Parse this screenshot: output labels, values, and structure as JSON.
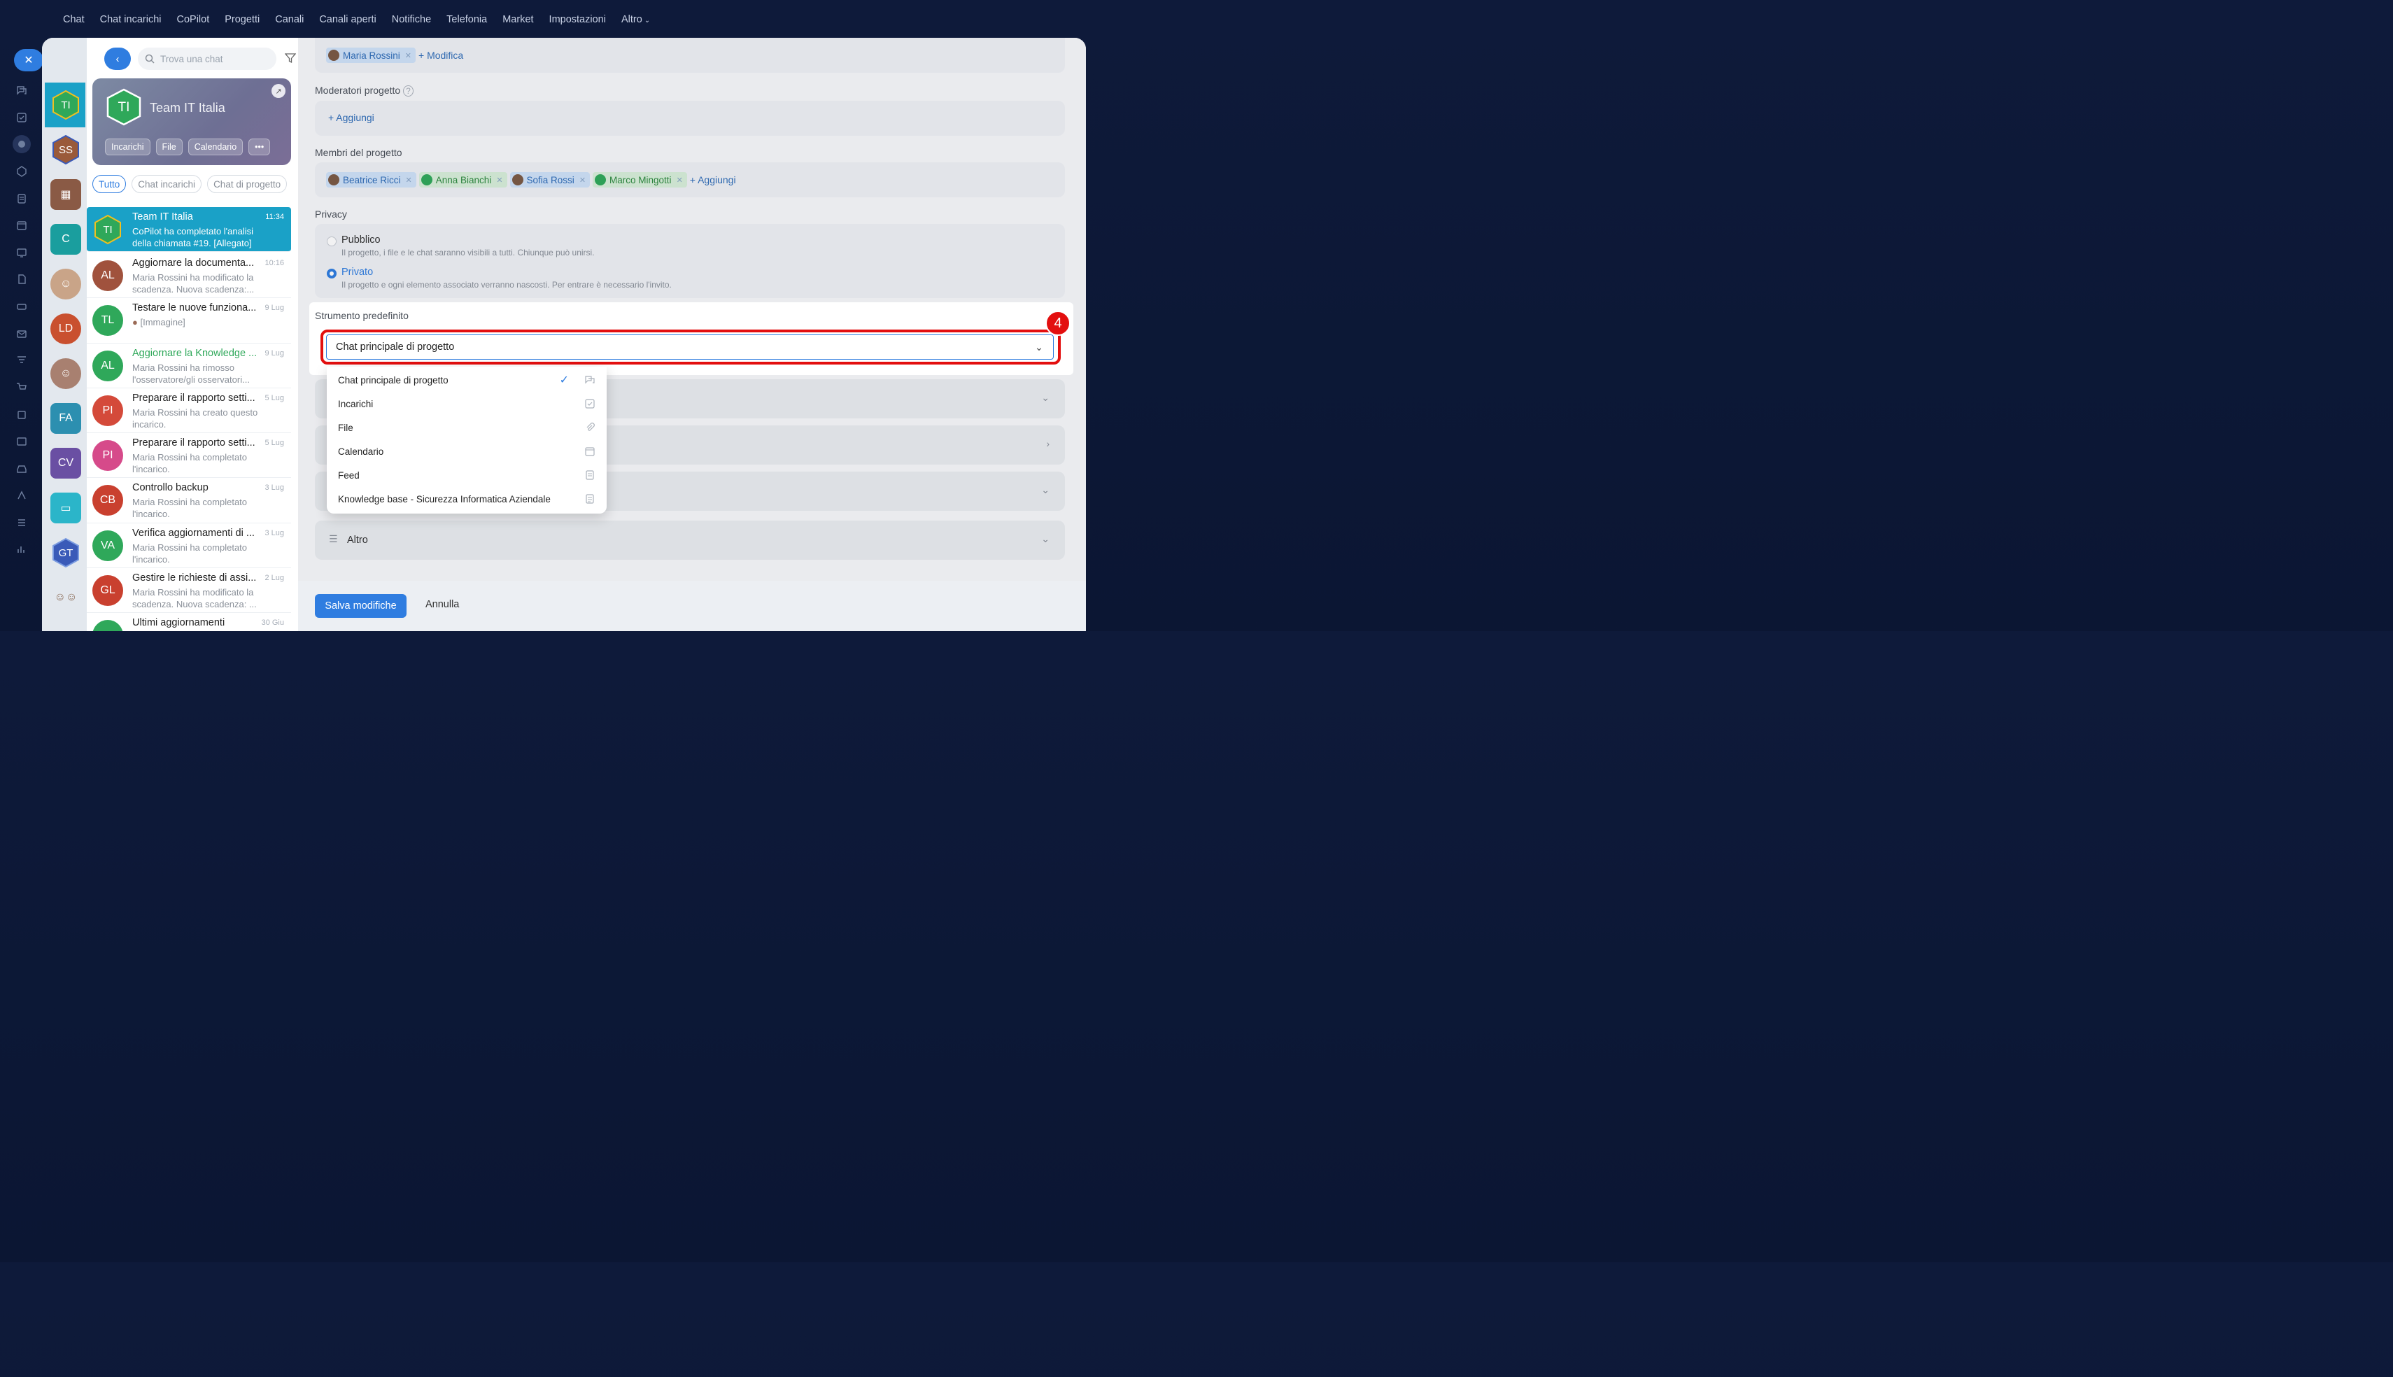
{
  "top_nav": {
    "items": [
      "Chat",
      "Chat incarichi",
      "CoPilot",
      "Progetti",
      "Canali",
      "Canali aperti",
      "Notifiche",
      "Telefonia",
      "Market",
      "Impostazioni",
      "Altro"
    ]
  },
  "avatar_column": {
    "items": [
      {
        "initials": "TI",
        "color": "#2fa85a"
      },
      {
        "initials": "SS",
        "color": "#9a5a3a"
      },
      {
        "initials": "",
        "color": "#8a5a45"
      },
      {
        "initials": "C",
        "color": "#1a9e9e"
      },
      {
        "initials": "",
        "color": "#b07a5a"
      },
      {
        "initials": "LD",
        "color": "#c9502f"
      },
      {
        "initials": "",
        "color": "#8a6a55"
      },
      {
        "initials": "FA",
        "color": "#2c8fb0"
      },
      {
        "initials": "CV",
        "color": "#6a4fa3"
      },
      {
        "initials": "",
        "color": "#2bb5c9"
      },
      {
        "initials": "GT",
        "color": "#3a5ab8"
      },
      {
        "initials": "",
        "color": "#c0a080"
      }
    ]
  },
  "chat_list": {
    "search_placeholder": "Trova una chat",
    "team_card": {
      "initials": "TI",
      "name": "Team IT Italia",
      "chips": [
        "Incarichi",
        "File",
        "Calendario",
        "•••"
      ]
    },
    "filters": [
      "Tutto",
      "Chat incarichi",
      "Chat di progetto"
    ],
    "items": [
      {
        "initials": "TI",
        "color": "#2fa85a",
        "title": "Team IT Italia",
        "time": "11:34",
        "message": "CoPilot ha completato l'analisi della chiamata #19. [Allegato]"
      },
      {
        "initials": "AL",
        "color": "#a0523d",
        "title": "Aggiornare la documenta...",
        "time": "10:16",
        "message": "Maria Rossini ha modificato la scadenza. Nuova scadenza:..."
      },
      {
        "initials": "TL",
        "color": "#2fa85a",
        "title": "Testare le nuove funziona...",
        "time": "9 Lug",
        "message": "[Immagine]"
      },
      {
        "initials": "AL",
        "color": "#2fa85a",
        "title": "Aggiornare la Knowledge ...",
        "time": "9 Lug",
        "message": "Maria Rossini ha rimosso l'osservatore/gli osservatori..."
      },
      {
        "initials": "PI",
        "color": "#d44a3a",
        "title": "Preparare il rapporto setti...",
        "time": "5 Lug",
        "message": "Maria Rossini ha creato questo incarico."
      },
      {
        "initials": "PI",
        "color": "#d64a8a",
        "title": "Preparare il rapporto setti...",
        "time": "5 Lug",
        "message": "Maria Rossini ha completato l'incarico."
      },
      {
        "initials": "CB",
        "color": "#c9402f",
        "title": "Controllo backup",
        "time": "3 Lug",
        "message": "Maria Rossini ha completato l'incarico."
      },
      {
        "initials": "VA",
        "color": "#2fa85a",
        "title": "Verifica aggiornamenti di ...",
        "time": "3 Lug",
        "message": "Maria Rossini ha completato l'incarico."
      },
      {
        "initials": "GL",
        "color": "#c9402f",
        "title": "Gestire le richieste di assi...",
        "time": "2 Lug",
        "message": "Maria Rossini ha modificato la scadenza. Nuova scadenza: ..."
      },
      {
        "initials": "",
        "color": "#2fa85a",
        "title": "Ultimi aggiornamenti",
        "time": "30 Giu",
        "message": ""
      }
    ]
  },
  "form": {
    "owner_tag": "Maria Rossini",
    "owner_action": "+ Modifica",
    "moderators_label": "Moderatori progetto",
    "moderators_action": "+ Aggiungi",
    "members_label": "Membri del progetto",
    "members": [
      {
        "name": "Beatrice Ricci",
        "style": "blue"
      },
      {
        "name": "Anna Bianchi",
        "style": "green"
      },
      {
        "name": "Sofia Rossi",
        "style": "blue"
      },
      {
        "name": "Marco Mingotti",
        "style": "green"
      }
    ],
    "members_action": "+ Aggiungi",
    "privacy_label": "Privacy",
    "privacy_options": [
      {
        "title": "Pubblico",
        "desc": "Il progetto, i file e le chat saranno visibili a tutti. Chiunque può unirsi.",
        "selected": false
      },
      {
        "title": "Privato",
        "desc": "Il progetto e ogni elemento associato verranno nascosti. Per entrare è necessario l'invito.",
        "selected": true
      }
    ],
    "default_tool_label": "Strumento predefinito",
    "default_tool_value": "Chat principale di progetto",
    "step_badge": "4",
    "dropdown_options": [
      {
        "label": "Chat principale di progetto",
        "icon": "chat-icon",
        "checked": true
      },
      {
        "label": "Incarichi",
        "icon": "checkbox-icon",
        "checked": false
      },
      {
        "label": "File",
        "icon": "paperclip-icon",
        "checked": false
      },
      {
        "label": "Calendario",
        "icon": "calendar-icon",
        "checked": false
      },
      {
        "label": "Feed",
        "icon": "feed-icon",
        "checked": false
      },
      {
        "label": "Knowledge base - Sicurezza Informatica Aziendale",
        "icon": "document-icon",
        "checked": false
      }
    ],
    "altro_label": "Altro"
  },
  "footer": {
    "save_label": "Salva modifiche",
    "cancel_label": "Annulla"
  }
}
